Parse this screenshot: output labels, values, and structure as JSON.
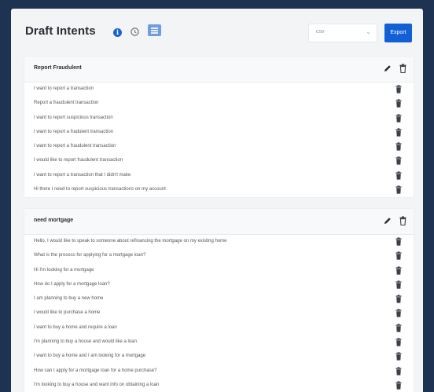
{
  "header": {
    "title": "Draft Intents",
    "format_select": {
      "value": "csv",
      "chevron": "chevron-down-icon"
    },
    "export_label": "Export"
  },
  "cards": [
    {
      "title": "Report Fraudulent",
      "intents": [
        "I want to report a transaction",
        "Report a fraudulent transaction",
        "I want to report suspicious transaction",
        "I want to report a fradulent transaction",
        "I want to report a fraudulent transaction",
        "I would like to report fraudulent transaction",
        "I want to report a transaction that I didn't make",
        "Hi there I need to report suspicious transactions on my account"
      ]
    },
    {
      "title": "need mortgage",
      "intents": [
        "Hello, I would like to speak to someone about refinancing the mortgage on my existing home",
        "What is the process for applying for a mortgage loan?",
        "Hi I'm looking for a mortgage",
        "How do I apply for a mortgage loan?",
        "I am planning to buy a new home",
        "I would like to purchase a home",
        "I want to buy a home and require a loan",
        "I'm planning to buy a house and would like a loan",
        "I want to buy a home and I am looking for a mortgage",
        "How can I apply for a mortgage loan for a home purchase?",
        "I'm looking to buy a house and want info on obtaining a loan"
      ]
    }
  ],
  "colors": {
    "background": "#1e3252",
    "primary": "#1260d6",
    "panel": "#f3f4f6"
  }
}
